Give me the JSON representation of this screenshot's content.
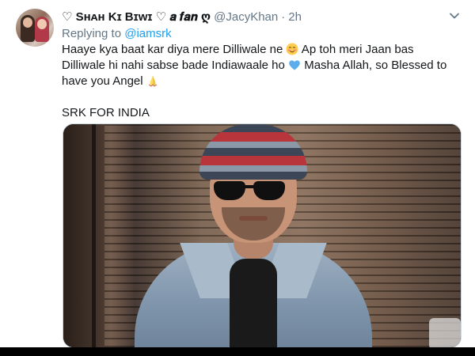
{
  "tweet": {
    "display_name": "♡ Sʜᴀʜ Kɪ Bɪᴡɪ ♡ 𝒂 𝒇𝒂𝒏 ღ",
    "handle": "@JacyKhan",
    "separator": "·",
    "time": "2h",
    "replying_prefix": "Replying to",
    "replying_handle": "@iamsrk",
    "text_segment_1": "Haaye kya baat kar diya mere Dilliwale ne",
    "text_segment_2": " Ap toh meri Jaan bas Dilliwale hi nahi sabse bade Indiawaale ho",
    "text_segment_3": " Masha Allah, so Blessed to have you Angel",
    "text_line_2": "SRK FOR INDIA"
  },
  "icons": {
    "more": "chevron-down-icon",
    "emoji_1": "smiling-face-emoji",
    "emoji_2": "blue-heart-emoji",
    "emoji_3": "folded-hands-emoji"
  },
  "colors": {
    "link": "#1da1f2",
    "secondary_text": "#657786",
    "primary_text": "#14171a",
    "heart": "#5dadec"
  }
}
